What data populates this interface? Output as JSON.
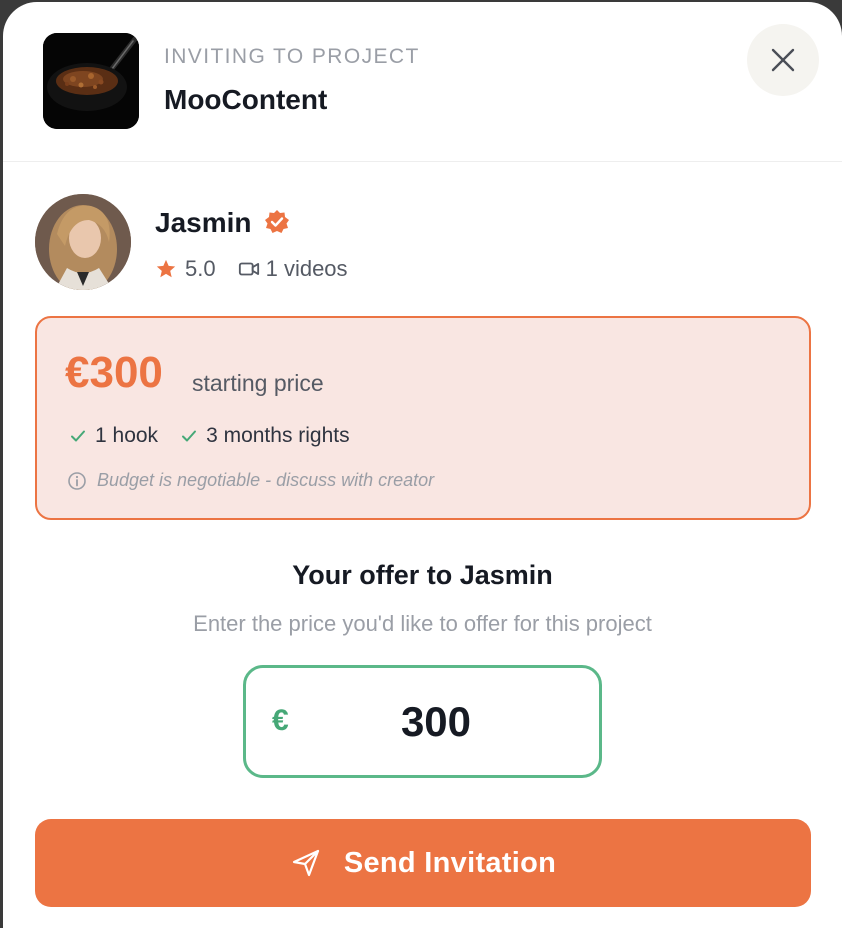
{
  "header": {
    "kicker": "INVITING TO PROJECT",
    "project_name": "MooContent",
    "thumbnail_icon": "food-bowl-image",
    "close_icon": "close-icon"
  },
  "creator": {
    "name": "Jasmin",
    "verified_icon": "verified-badge-icon",
    "rating": "5.0",
    "videos": "1 videos"
  },
  "pricing": {
    "amount": "€300",
    "suffix": "starting price",
    "features": [
      "1 hook",
      "3 months rights"
    ],
    "note": "Budget is negotiable - discuss with creator"
  },
  "offer": {
    "title": "Your offer to Jasmin",
    "subtitle": "Enter the price you'd like to offer for this project",
    "currency": "€",
    "value": "300"
  },
  "actions": {
    "send_label": "Send Invitation"
  },
  "colors": {
    "accent": "#ec7443",
    "accent_bg": "#f9e6e2",
    "input_border": "#5bb889",
    "text_dark": "#161a23",
    "text_muted": "#9a9ea6"
  }
}
